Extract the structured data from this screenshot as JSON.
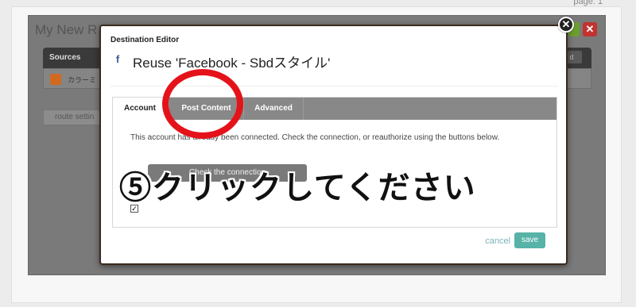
{
  "page": {
    "label": "page:",
    "number": "1"
  },
  "background": {
    "title": "My New R",
    "close_label": "✕",
    "sources_label": "Sources",
    "add_label": "d",
    "row_text": "カラーミ",
    "route_label": "route settin"
  },
  "modal": {
    "label": "Destination Editor",
    "title": "Reuse 'Facebook - Sbdスタイル'",
    "close_label": "✕",
    "icon": "facebook-icon",
    "tabs": [
      {
        "label": "Account",
        "active": true
      },
      {
        "label": "Post Content",
        "active": false
      },
      {
        "label": "Advanced",
        "active": false
      }
    ],
    "body_text": "This account has already been connected. Check the connection, or reauthorize using the buttons below.",
    "reauth_label": "Check the connection",
    "checkbox_checked": true,
    "cancel_label": "cancel",
    "save_label": "save"
  },
  "annotation": {
    "text": "⑤クリックしてください",
    "circle_color": "#e5121a"
  },
  "colors": {
    "save": "#57b2a7",
    "close_red": "#c2322e",
    "tab_bar": "#888888"
  }
}
